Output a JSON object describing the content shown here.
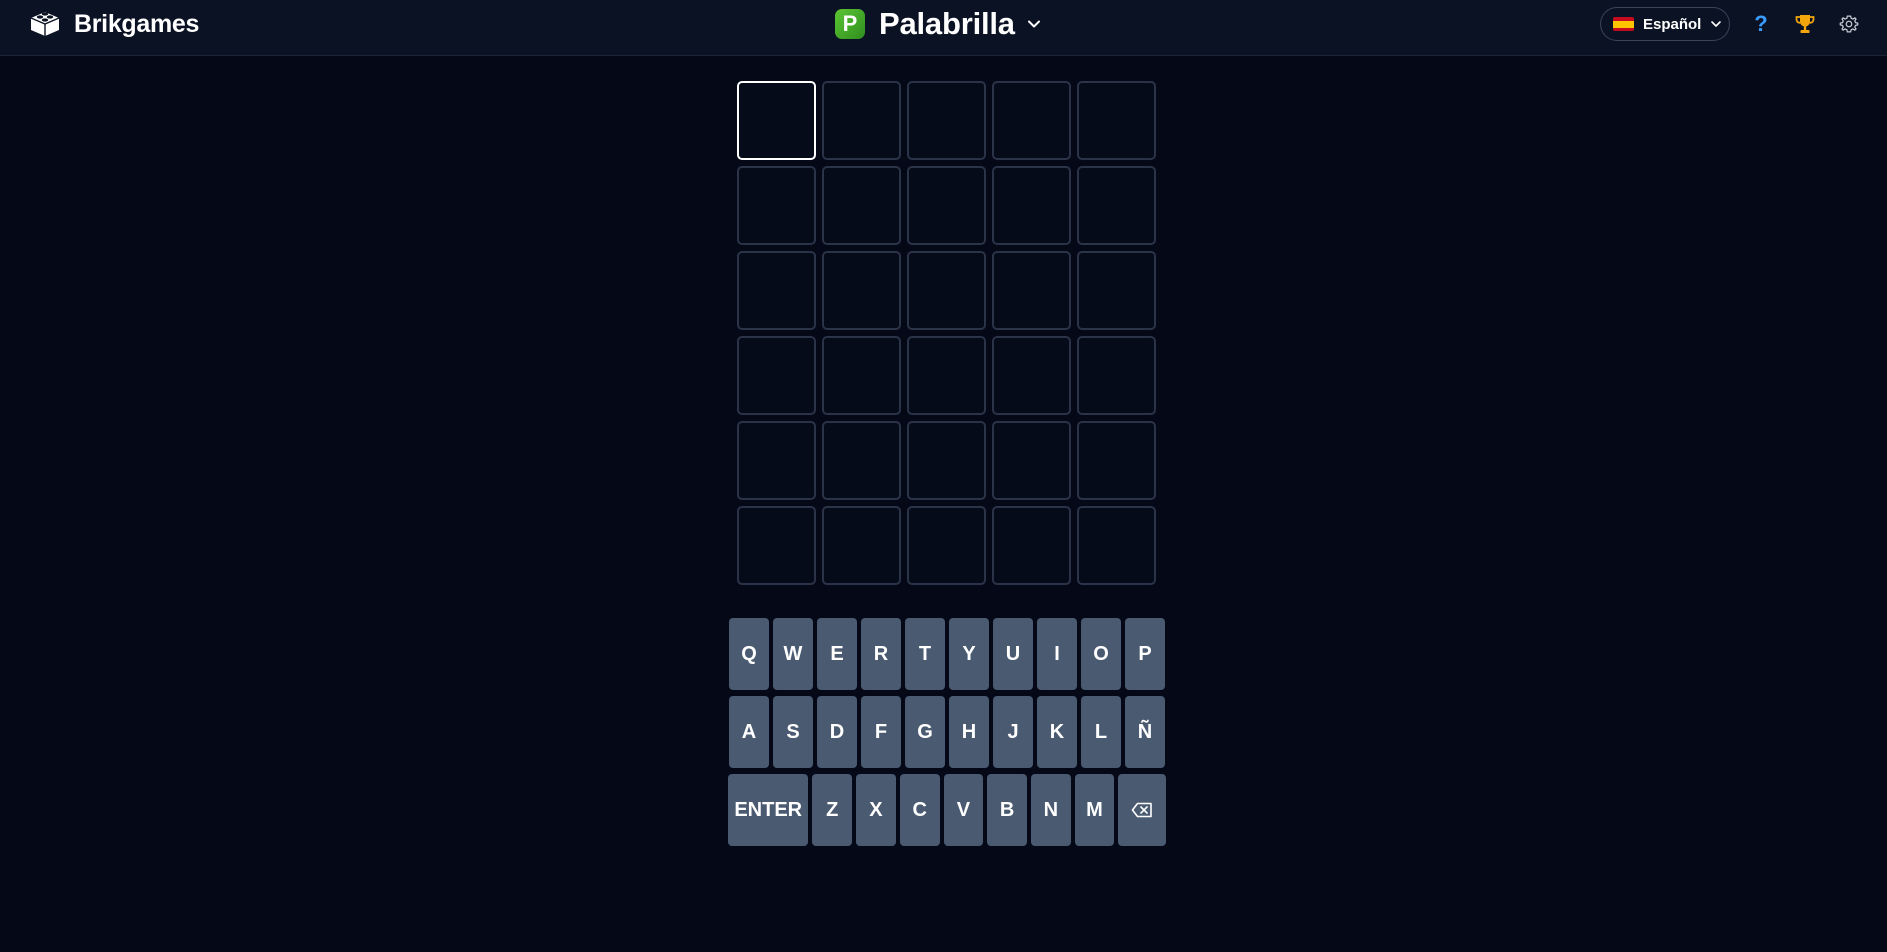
{
  "header": {
    "brand": "Brikgames",
    "game_logo_letter": "P",
    "game_title": "Palabrilla",
    "language": "Español",
    "help_label": "?",
    "icons": {
      "brand": "lego-brick-icon",
      "game_chevron": "chevron-down-icon",
      "language_flag": "spain-flag-icon",
      "language_chevron": "chevron-down-icon",
      "help": "question-mark-icon",
      "stats": "trophy-icon",
      "settings": "gear-icon"
    }
  },
  "board": {
    "rows": [
      [
        "",
        "",
        "",
        "",
        ""
      ],
      [
        "",
        "",
        "",
        "",
        ""
      ],
      [
        "",
        "",
        "",
        "",
        ""
      ],
      [
        "",
        "",
        "",
        "",
        ""
      ],
      [
        "",
        "",
        "",
        "",
        ""
      ],
      [
        "",
        "",
        "",
        "",
        ""
      ]
    ],
    "active_cell": [
      0,
      0
    ]
  },
  "keyboard": {
    "rows": [
      [
        "Q",
        "W",
        "E",
        "R",
        "T",
        "Y",
        "U",
        "I",
        "O",
        "P"
      ],
      [
        "A",
        "S",
        "D",
        "F",
        "G",
        "H",
        "J",
        "K",
        "L",
        "Ñ"
      ],
      [
        "ENTER",
        "Z",
        "X",
        "C",
        "V",
        "B",
        "N",
        "M",
        "⌫"
      ]
    ]
  },
  "colors": {
    "background": "#050816",
    "header_background": "#0b1224",
    "key_background": "#4a5a71",
    "tile_border": "#2a3348",
    "accent_green": "#4cb82a",
    "help_blue": "#3b9cff",
    "trophy_gold": "#f2a60c"
  }
}
